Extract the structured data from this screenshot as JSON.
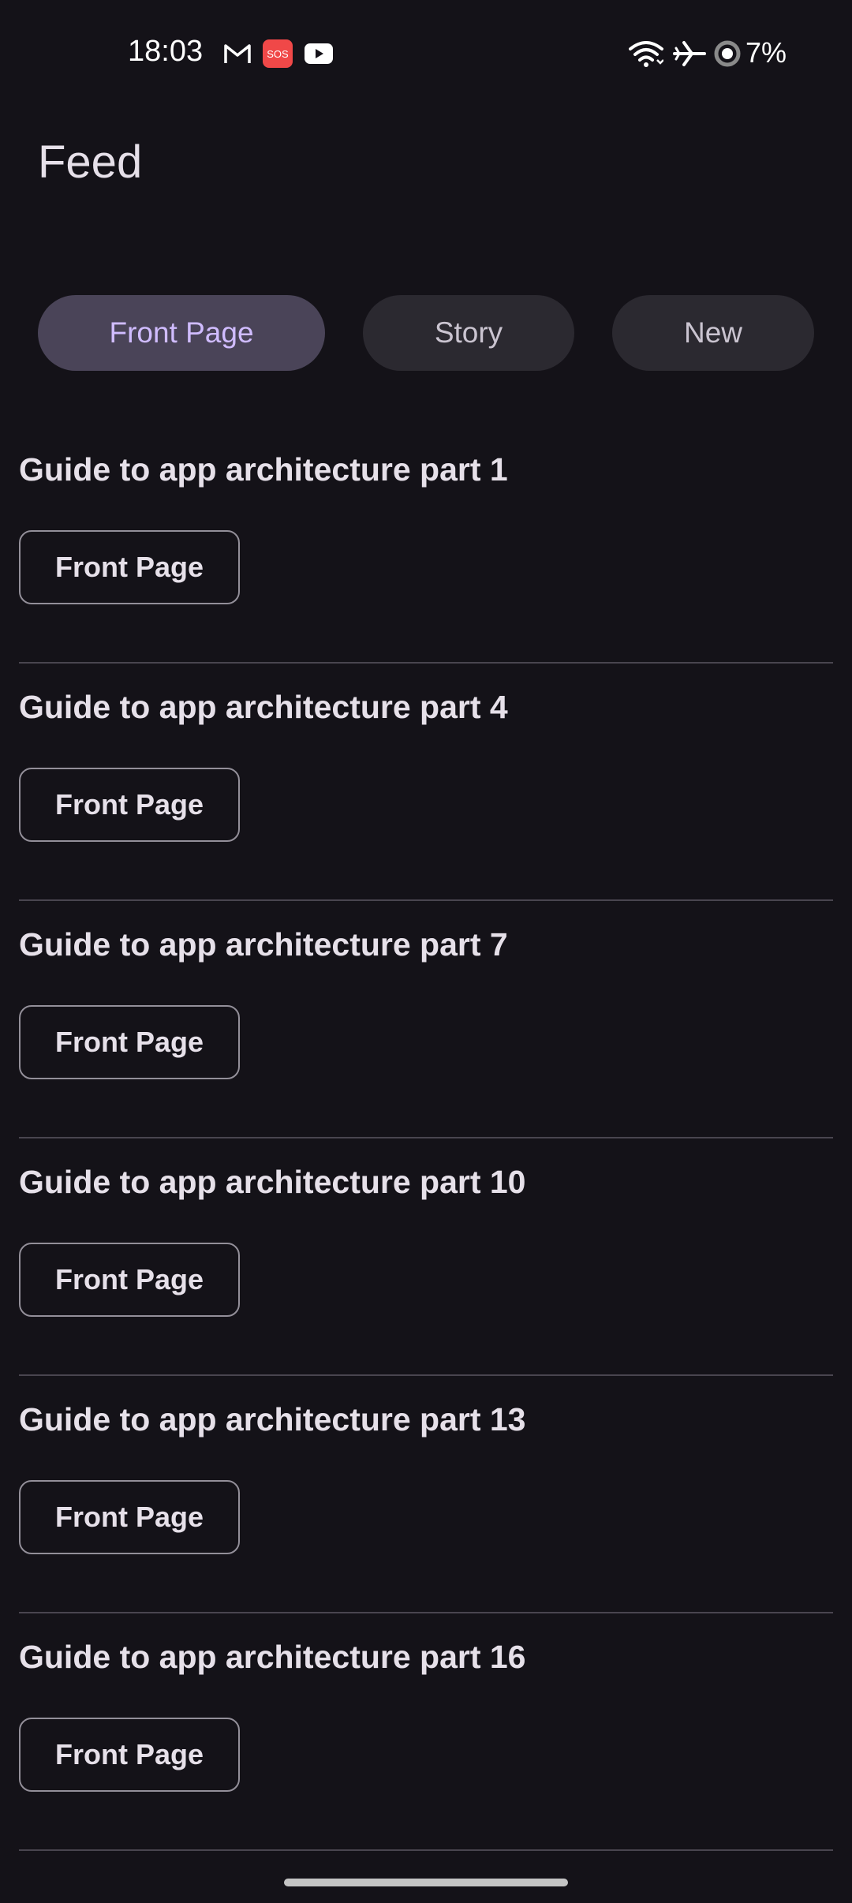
{
  "status_bar": {
    "time": "18:03",
    "battery_text": "7%",
    "icons": [
      "gmail-icon",
      "sos-icon",
      "youtube-icon",
      "wifi-icon",
      "airplane-mode-icon",
      "battery-ring-icon"
    ],
    "sos_label": "SOS"
  },
  "header": {
    "title": "Feed"
  },
  "tabs": [
    {
      "label": "Front Page",
      "selected": true
    },
    {
      "label": "Story",
      "selected": false
    },
    {
      "label": "New",
      "selected": false
    }
  ],
  "feed": {
    "items": [
      {
        "title": "Guide to app architecture part 1",
        "tag": "Front Page"
      },
      {
        "title": "Guide to app architecture part 4",
        "tag": "Front Page"
      },
      {
        "title": "Guide to app architecture part 7",
        "tag": "Front Page"
      },
      {
        "title": "Guide to app architecture part 10",
        "tag": "Front Page"
      },
      {
        "title": "Guide to app architecture part 13",
        "tag": "Front Page"
      },
      {
        "title": "Guide to app architecture part 16",
        "tag": "Front Page"
      }
    ]
  },
  "colors": {
    "background": "#141218",
    "selected_tab_bg": "#4a4458",
    "selected_tab_text": "#d0bcff",
    "tab_bg": "#2b2930",
    "sos_red": "#f04848"
  }
}
